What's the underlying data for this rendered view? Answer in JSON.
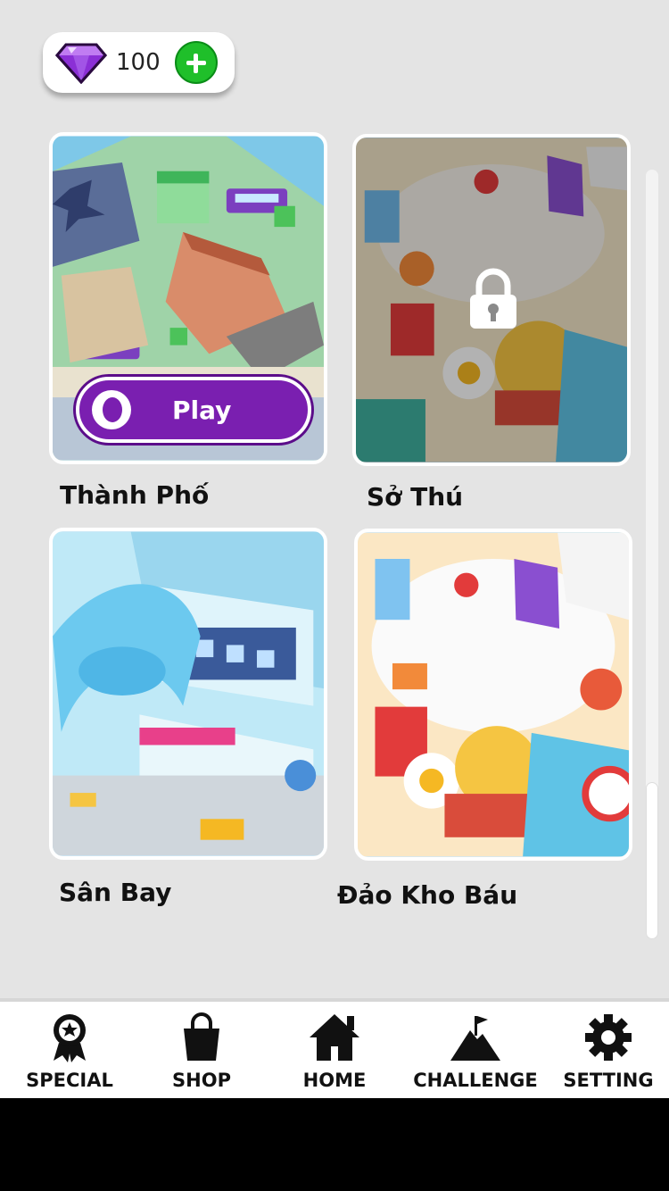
{
  "currency": {
    "gem_count": "100",
    "icon": "gem-icon",
    "add_icon": "plus-icon"
  },
  "levels": [
    {
      "name": "Thành Phố",
      "locked": false,
      "play_label": "Play"
    },
    {
      "name": "Sở Thú",
      "locked": true
    },
    {
      "name": "Sân Bay",
      "locked": false
    },
    {
      "name": "Đảo Kho Báu",
      "locked": false
    }
  ],
  "tabs": [
    {
      "label": "SPECIAL",
      "icon": "ribbon-icon"
    },
    {
      "label": "SHOP",
      "icon": "shopping-bag-icon"
    },
    {
      "label": "HOME",
      "icon": "house-icon"
    },
    {
      "label": "CHALLENGE",
      "icon": "mountain-flag-icon"
    },
    {
      "label": "SETTING",
      "icon": "gear-icon"
    }
  ],
  "colors": {
    "accent": "#7a1fb0",
    "add_green": "#1fbf2a",
    "background": "#e4e4e4"
  }
}
